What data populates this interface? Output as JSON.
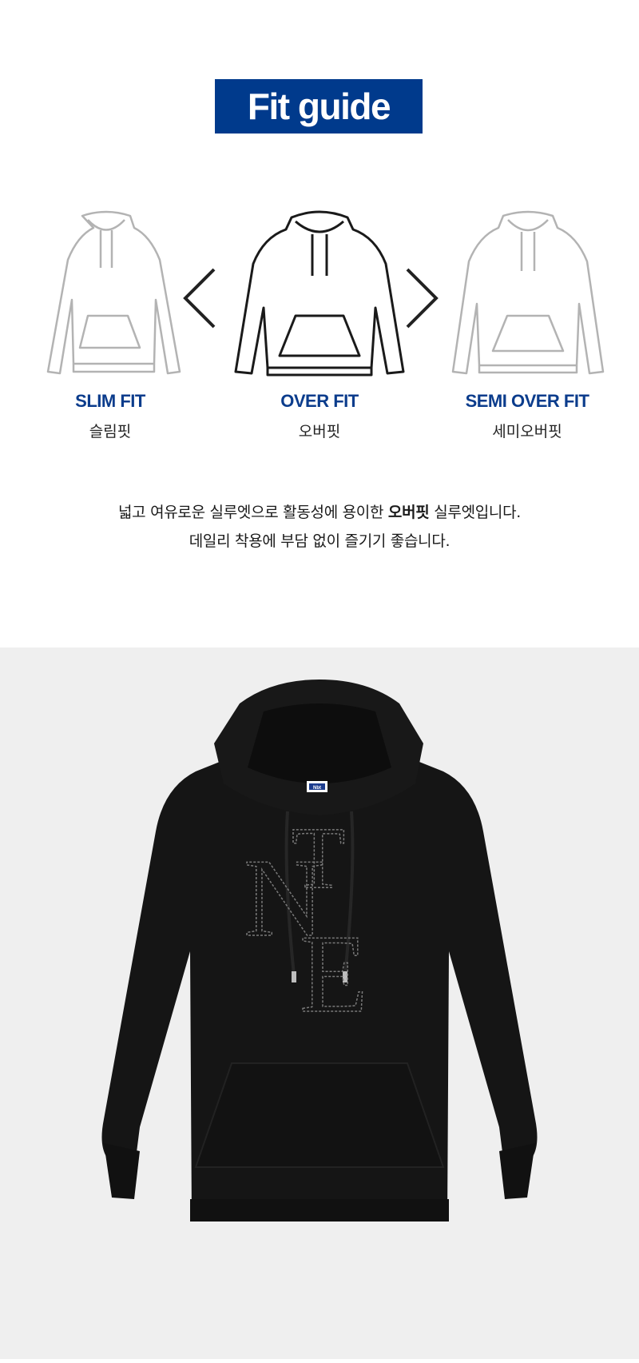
{
  "header": {
    "title": "Fit guide"
  },
  "fits": [
    {
      "label": "SLIM FIT",
      "sub": "슬림핏"
    },
    {
      "label": "OVER FIT",
      "sub": "오버핏"
    },
    {
      "label": "SEMI OVER FIT",
      "sub": "세미오버핏"
    }
  ],
  "arrows": {
    "left": "<",
    "right": ">"
  },
  "description": {
    "line1_prefix": "넓고 여유로운 실루엣으로 활동성에 용이한 ",
    "line1_bold": "오버핏",
    "line1_suffix": " 실루엣입니다.",
    "line2": "데일리 착용에 부담 없이 즐기기 좋습니다."
  },
  "product": {
    "label_tag": "Nbt",
    "logo_letters": [
      "N",
      "T",
      "E"
    ]
  },
  "colors": {
    "title_bg": "#003a8c",
    "fit_label": "#0b3c8c",
    "photo_bg": "#efefef",
    "hoodie": "#141414"
  }
}
